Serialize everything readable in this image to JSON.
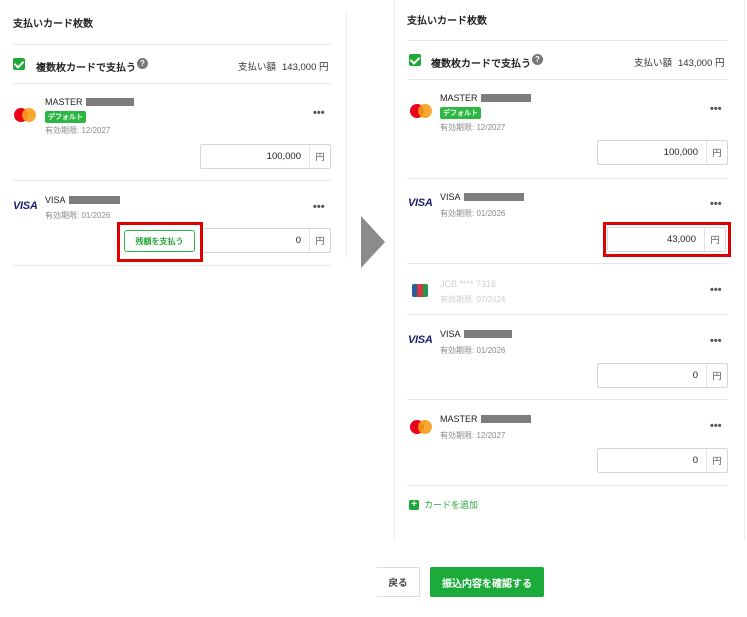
{
  "left": {
    "title": "支払いカード枚数",
    "multi_label": "複数枚カードで支払う",
    "total_label": "支払い額",
    "total_value": "143,000 円",
    "cards": [
      {
        "brand": "MASTER",
        "badge": "デフォルト",
        "expiry": "有効期限: 12/2027",
        "amount": "100,000"
      },
      {
        "brand": "VISA",
        "expiry": "有効期限: 01/2026",
        "amount": "0"
      }
    ],
    "remain_button": "残額を支払う"
  },
  "right": {
    "title": "支払いカード枚数",
    "multi_label": "複数枚カードで支払う",
    "total_label": "支払い額",
    "total_value": "143,000 円",
    "cards": [
      {
        "brand": "MASTER",
        "badge": "デフォルト",
        "expiry": "有効期限: 12/2027",
        "amount": "100,000"
      },
      {
        "brand": "VISA",
        "expiry": "有効期限: 01/2026",
        "amount": "43,000"
      },
      {
        "brand": "JCB **** 7318",
        "expiry": "有効期限: 07/2024"
      },
      {
        "brand": "VISA",
        "expiry": "有効期限: 01/2026",
        "amount": "0"
      },
      {
        "brand": "MASTER",
        "expiry": "有効期限: 12/2027",
        "amount": "0"
      }
    ],
    "add_card": "カードを追加"
  },
  "unit": "円",
  "more": "•••",
  "help": "?",
  "plus": "+",
  "visa_logo": "VISA",
  "footer": {
    "back": "戻る",
    "confirm": "振込内容を確認する"
  },
  "colors": {
    "accent": "#1fa838",
    "highlight": "#e00000"
  }
}
